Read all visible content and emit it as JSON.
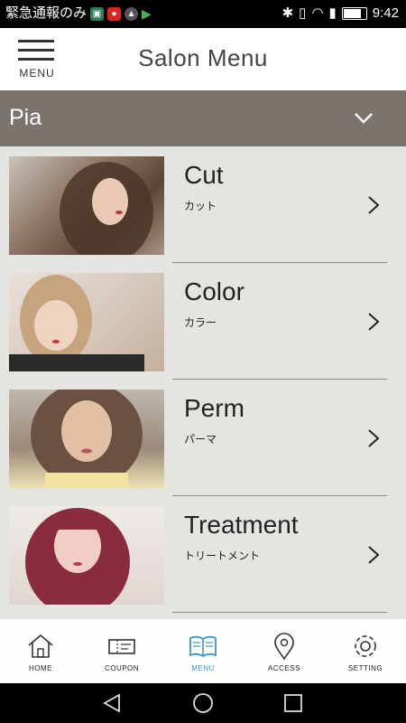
{
  "status_bar": {
    "notification_text": "緊急通報のみ",
    "time": "9:42"
  },
  "header": {
    "menu_label": "MENU",
    "title": "Salon Menu"
  },
  "salon": {
    "name": "Pia"
  },
  "menu_items": [
    {
      "title": "Cut",
      "subtitle": "カット"
    },
    {
      "title": "Color",
      "subtitle": "カラー"
    },
    {
      "title": "Perm",
      "subtitle": "パーマ"
    },
    {
      "title": "Treatment",
      "subtitle": "トリートメント"
    }
  ],
  "tabs": [
    {
      "label": "HOME",
      "icon": "home-icon"
    },
    {
      "label": "COUPON",
      "icon": "coupon-icon"
    },
    {
      "label": "MENU",
      "icon": "book-icon",
      "active": true
    },
    {
      "label": "ACCESS",
      "icon": "map-pin-icon"
    },
    {
      "label": "SETTING",
      "icon": "gear-icon"
    }
  ],
  "colors": {
    "accent": "#3a96c8",
    "salon_bar": "#7b746e",
    "list_background": "#e4e4e1"
  }
}
